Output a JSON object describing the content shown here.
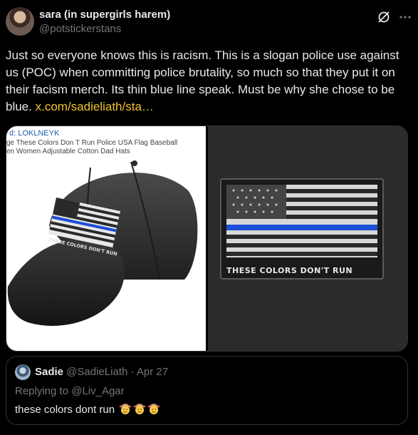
{
  "author": {
    "display_name": "sara (in supergirls harem)",
    "handle": "@potstickerstans"
  },
  "icons": {
    "grok": "grok-icon",
    "more": "more-dots-icon"
  },
  "tweet": {
    "text": "Just so everyone knows this is racism. This is a slogan police use against us (POC) when committing police brutality, so much so that they put it on their facism merch. Its thin blue line speak. Must be why she chose to be blue.",
    "link": "x.com/sadieliath/sta…",
    "link_color": "#f0c330"
  },
  "media": {
    "left": {
      "brand": "d: LOKLNEYK",
      "product_line_1": "ge These Colors Don T Run Police USA Flag Baseball",
      "product_line_2": "en Women Adjustable Cotton Dad Hats",
      "hat_text": "THESE COLORS DON'T RUN"
    },
    "right": {
      "patch_text": "THESE COLORS DON'T RUN"
    }
  },
  "quote": {
    "name": "Sadie",
    "handle": "@SadieLiath",
    "separator": "·",
    "date": "Apr 27",
    "replying_to": "Replying to @Liv_Agar",
    "text": "these colors dont run",
    "emoji": [
      "cowboy-hat-face",
      "cowboy-hat-face",
      "cowboy-hat-face"
    ]
  }
}
